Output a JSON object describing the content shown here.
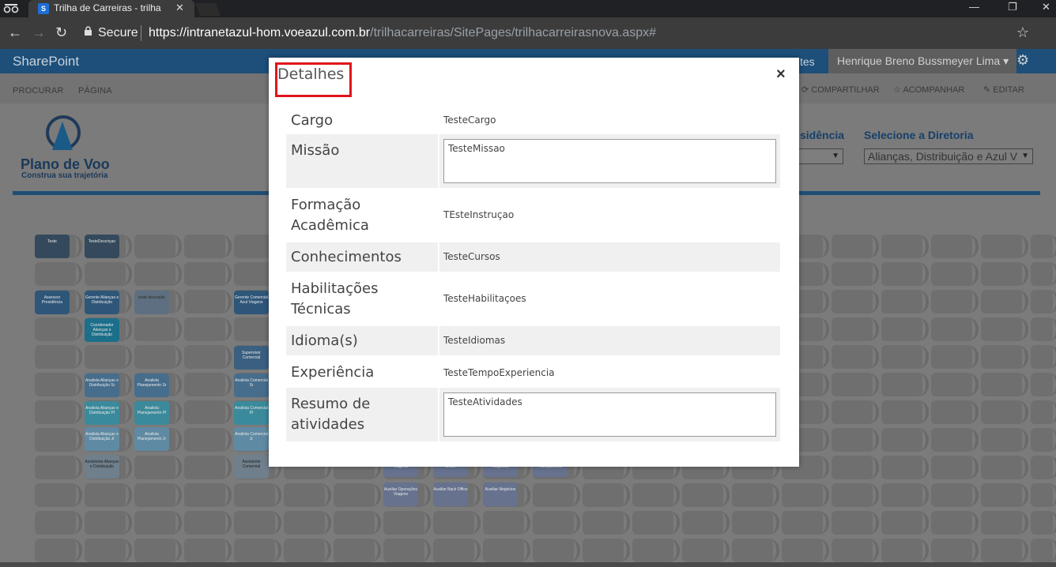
{
  "browser": {
    "tab_title": "Trilha de Carreiras - trilha",
    "tab_icon": "S",
    "secure_label": "Secure",
    "url_host": "https://intranetazul-hom.voeazul.com.br",
    "url_path": "/trilhacarreiras/SitePages/trilhacarreirasnova.aspx#"
  },
  "suitebar": {
    "brand": "SharePoint",
    "fragment": "tes",
    "user": "Henrique Breno Bussmeyer Lima ▾"
  },
  "ribbon": {
    "procurar": "PROCURAR",
    "pagina": "PÁGINA",
    "compartilhar": "COMPARTILHAR",
    "acompanhar": "ACOMPANHAR",
    "editar": "EDITAR"
  },
  "page": {
    "logo_title": "Plano de Voo",
    "logo_subtitle": "Construa sua trajetória",
    "presidencia_label": "sidência",
    "diretoria_label": "Selecione a Diretoria",
    "diretoria_value": "Alianças, Distribuição e Azul V"
  },
  "grid_labels": {
    "teste": "Teste",
    "teste_descricao": "TesteDescriçao",
    "assessor": "Assessor Presidência",
    "gerente": "Gerente Alianças e Distribuição",
    "teste_desc2": "teste descrição",
    "gerente_comercial": "Gerente Comercial Azul Viagens",
    "coordenador": "Coordenador Alianças e Distribuição",
    "supervisor": "Supervisor Comercial",
    "analista_sr": "Analista Alianças e Distribuição Sr",
    "analista_planej_sr": "Analista Planejamento Sr",
    "analista_com_sr": "Analista Comercial Sr",
    "analista_pl": "Analista Alianças e Distribuição Pl",
    "analista_planej_pl": "Analista Planejamento Pl",
    "analista_com_pl": "Analista Comercial Pl",
    "analista_jr": "Analista Alianças e Distribuição Jr",
    "analista_planej_jr": "Analista Planejamento Jr",
    "analista_com_jr": "Analista Comercial Jr",
    "assistente": "Assistente Alianças e Distribuição",
    "assistente_com": "Assistente Comercial",
    "aux_viagens": "Viagens",
    "aux_office": "Office",
    "aux_negocios": "Negócios",
    "aux_planej": "Planejamento",
    "auxiliar_op": "Auxiliar Operações Viagens",
    "auxiliar_bo": "Auxiliar Back Office",
    "auxiliar_neg": "Auxiliar Negócios"
  },
  "modal": {
    "title": "Detalhes",
    "close": "×",
    "rows": [
      {
        "label": "Cargo",
        "value": "TesteCargo"
      },
      {
        "label": "Missão",
        "value": "TesteMissao"
      },
      {
        "label": "Formação Acadêmica",
        "value": "TEsteInstruçao"
      },
      {
        "label": "Conhecimentos",
        "value": "TesteCursos"
      },
      {
        "label": "Habilitações Técnicas",
        "value": "TesteHabilitaçoes"
      },
      {
        "label": "Idioma(s)",
        "value": "TesteIdiomas"
      },
      {
        "label": "Experiência",
        "value": "TesteTempoExperiencia"
      },
      {
        "label": "Resumo de atividades",
        "value": "TesteAtividades"
      }
    ]
  }
}
